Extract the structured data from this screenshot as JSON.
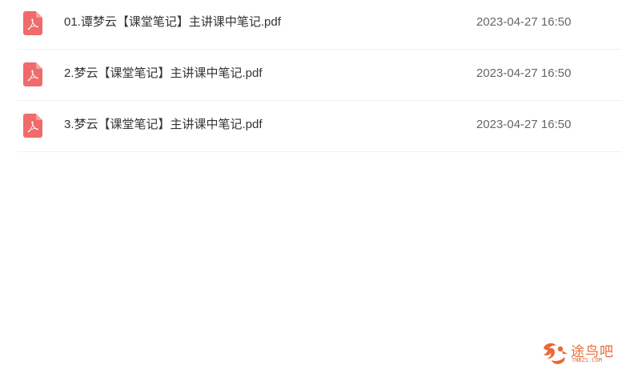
{
  "files": [
    {
      "icon": "pdf-file-icon",
      "name": "01.谭梦云【课堂笔记】主讲课中笔记.pdf",
      "date": "2023-04-27 16:50"
    },
    {
      "icon": "pdf-file-icon",
      "name": "2.梦云【课堂笔记】主讲课中笔记.pdf",
      "date": "2023-04-27 16:50"
    },
    {
      "icon": "pdf-file-icon",
      "name": "3.梦云【课堂笔记】主讲课中笔记.pdf",
      "date": "2023-04-27 16:50"
    }
  ],
  "watermark": {
    "text": "途鸟吧",
    "subtext": "TNBZS.COM"
  },
  "colors": {
    "pdf_icon": "#f06b6b",
    "watermark": "#e8693a",
    "row_divider": "#f0f0f0"
  }
}
